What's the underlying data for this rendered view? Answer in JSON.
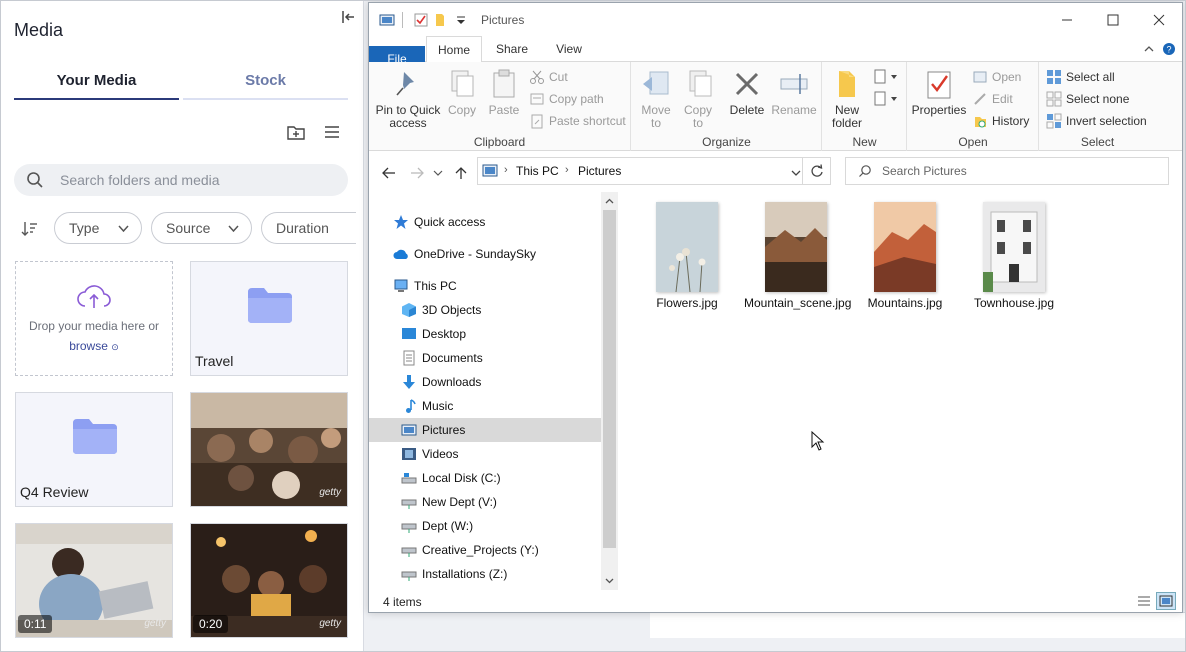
{
  "media": {
    "title": "Media",
    "tabs": [
      "Your Media",
      "Stock"
    ],
    "search_placeholder": "Search folders and media",
    "filters": [
      "Type",
      "Source",
      "Duration"
    ],
    "dropzone": {
      "line1": "Drop your media here or",
      "browse": "browse"
    },
    "folders": [
      "Travel",
      "Q4 Review"
    ],
    "videos": [
      {
        "duration": "0:11",
        "watermark": "getty"
      },
      {
        "duration": "0:20",
        "watermark": "getty"
      }
    ],
    "photo_watermark": "getty"
  },
  "explorer": {
    "title": "Pictures",
    "ribbon_tabs": [
      "File",
      "Home",
      "Share",
      "View"
    ],
    "clipboard": {
      "pin": "Pin to Quick access",
      "copy": "Copy",
      "paste": "Paste",
      "cut": "Cut",
      "copy_path": "Copy path",
      "paste_shortcut": "Paste shortcut",
      "group": "Clipboard"
    },
    "organize": {
      "move_to": "Move to",
      "copy_to": "Copy to",
      "delete": "Delete",
      "rename": "Rename",
      "group": "Organize"
    },
    "new": {
      "new_folder": "New folder",
      "group": "New"
    },
    "open": {
      "properties": "Properties",
      "open": "Open",
      "edit": "Edit",
      "history": "History",
      "group": "Open"
    },
    "select": {
      "select_all": "Select all",
      "select_none": "Select none",
      "invert": "Invert selection",
      "group": "Select"
    },
    "address": {
      "crumbs": [
        "This PC",
        "Pictures"
      ]
    },
    "search_placeholder": "Search Pictures",
    "nav": [
      {
        "label": "Quick access",
        "icon": "star-icon"
      },
      {
        "label": "OneDrive - SundaySky",
        "icon": "cloud-icon"
      },
      {
        "label": "This PC",
        "icon": "computer-icon"
      },
      {
        "label": "3D Objects",
        "icon": "cube-icon"
      },
      {
        "label": "Desktop",
        "icon": "desktop-icon"
      },
      {
        "label": "Documents",
        "icon": "document-icon"
      },
      {
        "label": "Downloads",
        "icon": "download-icon"
      },
      {
        "label": "Music",
        "icon": "music-icon"
      },
      {
        "label": "Pictures",
        "icon": "pictures-icon"
      },
      {
        "label": "Videos",
        "icon": "videos-icon"
      },
      {
        "label": "Local Disk (C:)",
        "icon": "drive-icon"
      },
      {
        "label": "New Dept (V:)",
        "icon": "network-drive-icon"
      },
      {
        "label": "Dept (W:)",
        "icon": "network-drive-icon"
      },
      {
        "label": "Creative_Projects (Y:)",
        "icon": "network-drive-icon"
      },
      {
        "label": "Installations (Z:)",
        "icon": "network-drive-icon"
      }
    ],
    "selected_nav": "Pictures",
    "files": [
      {
        "name": "Flowers.jpg"
      },
      {
        "name": "Mountain_scene.jpg"
      },
      {
        "name": "Mountains.jpg"
      },
      {
        "name": "Townhouse.jpg"
      }
    ],
    "status": "4 items"
  }
}
